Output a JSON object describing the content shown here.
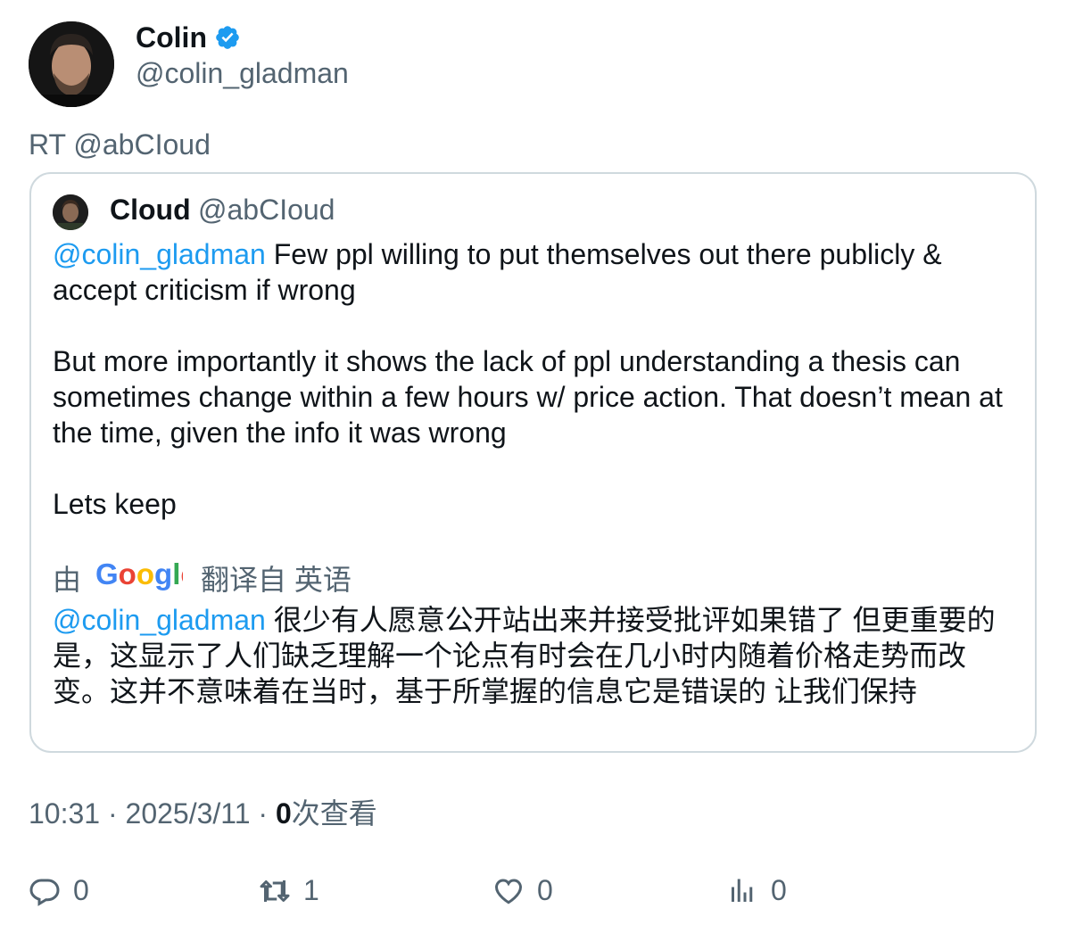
{
  "author": {
    "name": "Colin",
    "handle": "@colin_gladman",
    "verified_icon": "verified-badge-icon",
    "verified_color": "#1d9bf0"
  },
  "retweet_line": "RT @abCIoud",
  "quoted": {
    "name": "Cloud",
    "handle": "@abCIoud",
    "mention": "@colin_gladman",
    "p1_rest": " Few ppl willing to put themselves out there publicly & accept criticism if wrong",
    "p2": "But more importantly it shows the lack of ppl understanding a thesis can sometimes change within a few hours w/  price action. That doesn’t mean at the time, given the info it was wrong",
    "p3": "Lets keep",
    "translation": {
      "by": "由",
      "provider": "Google",
      "from": "翻译自 英语",
      "mention": "@colin_gladman",
      "text": " 很少有人愿意公开站出来并接受批评如果错了 但更重要的是，这显示了人们缺乏理解一个论点有时会在几小时内随着价格走势而改变。这并不意味着在当时，基于所掌握的信息它是错误的 让我们保持"
    }
  },
  "meta": {
    "time": "10:31",
    "sep": " · ",
    "date": "2025/3/11",
    "views_count": "0",
    "views_label": "次查看"
  },
  "actions": {
    "reply": {
      "icon": "reply-icon",
      "count": "0"
    },
    "retweet": {
      "icon": "retweet-icon",
      "count": "1"
    },
    "like": {
      "icon": "heart-icon",
      "count": "0"
    },
    "views": {
      "icon": "analytics-icon",
      "count": "0"
    }
  },
  "colors": {
    "accent": "#1d9bf0",
    "secondary_text": "#536471",
    "border": "#cfd9de"
  }
}
